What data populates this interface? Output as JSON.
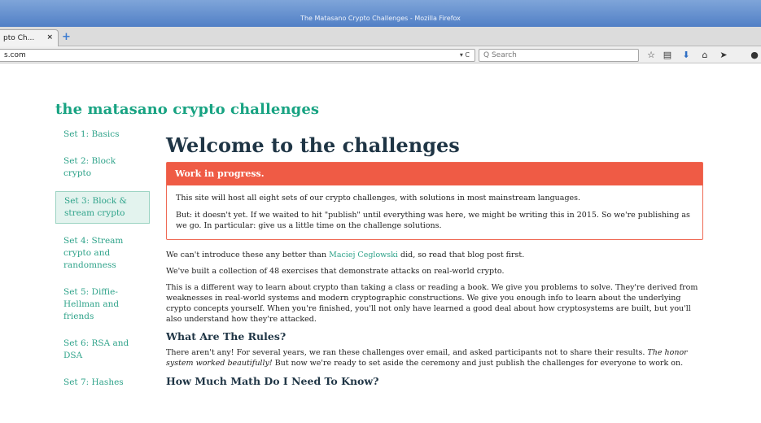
{
  "window": {
    "title": "The Matasano Crypto Challenges - Mozilla Firefox"
  },
  "tab": {
    "label": "pto Ch...",
    "close": "×",
    "new_tab": "+"
  },
  "navbar": {
    "url": "s.com",
    "url_controls": "▾ C",
    "search_placeholder": "Q Search",
    "icons": [
      "star-icon",
      "reading-list-icon",
      "download-icon",
      "home-icon",
      "send-icon",
      "menu-icon"
    ]
  },
  "site": {
    "title": "the matasano crypto challenges"
  },
  "sidebar": {
    "items": [
      {
        "label": "Set 1: Basics"
      },
      {
        "label": "Set 2: Block crypto"
      },
      {
        "label": "Set 3: Block & stream crypto",
        "active": true
      },
      {
        "label": "Set 4: Stream crypto and randomness"
      },
      {
        "label": "Set 5: Diffie-Hellman and friends"
      },
      {
        "label": "Set 6: RSA and DSA"
      },
      {
        "label": "Set 7: Hashes"
      }
    ]
  },
  "main": {
    "heading": "Welcome to the challenges",
    "alert": {
      "title": "Work in progress.",
      "p1": "This site will host all eight sets of our crypto challenges, with solutions in most mainstream languages.",
      "p2": "But: it doesn't yet. If we waited to hit \"publish\" until everything was here, we might be writing this in 2015. So we're publishing as we go. In particular: give us a little time on the challenge solutions."
    },
    "intro1_pre": "We can't introduce these any better than ",
    "intro1_link": "Maciej Ceglowski",
    "intro1_post": " did, so read that blog post first.",
    "intro2": "We've built a collection of 48 exercises that demonstrate attacks on real-world crypto.",
    "intro3": "This is a different way to learn about crypto than taking a class or reading a book. We give you problems to solve. They're derived from weaknesses in real-world systems and modern cryptographic constructions. We give you enough info to learn about the underlying crypto concepts yourself. When you're finished, you'll not only have learned a good deal about how cryptosystems are built, but you'll also understand how they're attacked.",
    "rules_heading": "What Are The Rules?",
    "rules_pre": "There aren't any! For several years, we ran these challenges over email, and asked participants not to share their results. ",
    "rules_em": "The honor system worked beautifully!",
    "rules_post": " But now we're ready to set aside the ceremony and just publish the challenges for everyone to work on.",
    "math_heading": "How Much Math Do I Need To Know?"
  }
}
